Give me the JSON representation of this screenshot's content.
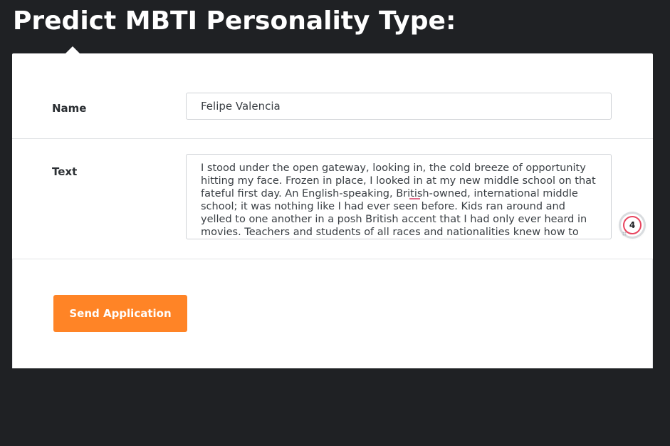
{
  "page": {
    "title": "Predict MBTI Personality Type:"
  },
  "form": {
    "name_label": "Name",
    "name_value": "Felipe Valencia",
    "text_label": "Text",
    "text_value": "I stood under the open gateway, looking in, the cold breeze of opportunity hitting my face. Frozen in place, I looked in at my new middle school on that fateful first day. An English-speaking, British-owned, international middle school; it was nothing like I had ever seen before. Kids ran around and yelled to one another in a posh British accent that I had only ever heard in movies. Teachers and students of all races and nationalities knew how to decrypt the",
    "submit_label": "Send Application"
  },
  "grammar_checker": {
    "issue_count": "4",
    "accent_color": "#e8455f"
  },
  "colors": {
    "background": "#1f2124",
    "card": "#ffffff",
    "button": "#ff8426"
  }
}
